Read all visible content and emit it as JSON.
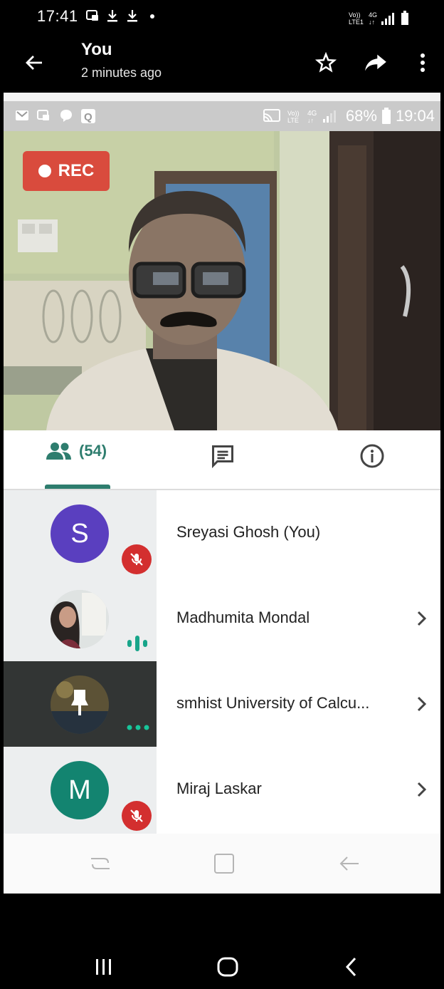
{
  "outer_status": {
    "time": "17:41",
    "icons": [
      "screenshot-icon",
      "download-icon",
      "download-icon",
      "dot-icon"
    ],
    "network": [
      "Vo)) LTE1",
      "4G",
      "signal",
      "battery"
    ]
  },
  "header": {
    "title": "You",
    "subtitle": "2 minutes ago",
    "actions": [
      "star-icon",
      "share-icon",
      "more-vert-icon"
    ]
  },
  "inner_status": {
    "left_icons": [
      "gmail-icon",
      "screenshot-icon",
      "chat-icon",
      "q-icon"
    ],
    "battery": "68%",
    "time": "19:04"
  },
  "video": {
    "rec_label": "REC"
  },
  "tabs": {
    "people_count": "(54)",
    "active": "people"
  },
  "participants": [
    {
      "initial": "S",
      "name": "Sreyasi Ghosh (You)",
      "avatar_color": "#5a3fbf",
      "status": "muted",
      "has_chevron": false
    },
    {
      "initial": "",
      "name": "Madhumita Mondal",
      "avatar_color": "#cfd4d4",
      "status": "speaking",
      "has_chevron": true
    },
    {
      "initial": "",
      "name": "smhist University of Calcu...",
      "avatar_color": "#4a4a3a",
      "status": "pinned",
      "has_chevron": true
    },
    {
      "initial": "M",
      "name": "Miraj Laskar",
      "avatar_color": "#138470",
      "status": "muted",
      "has_chevron": true
    }
  ],
  "colors": {
    "accent": "#2e7d6e",
    "rec": "#d94b3d",
    "mute": "#d32f2f",
    "speaking": "#18a58a"
  }
}
